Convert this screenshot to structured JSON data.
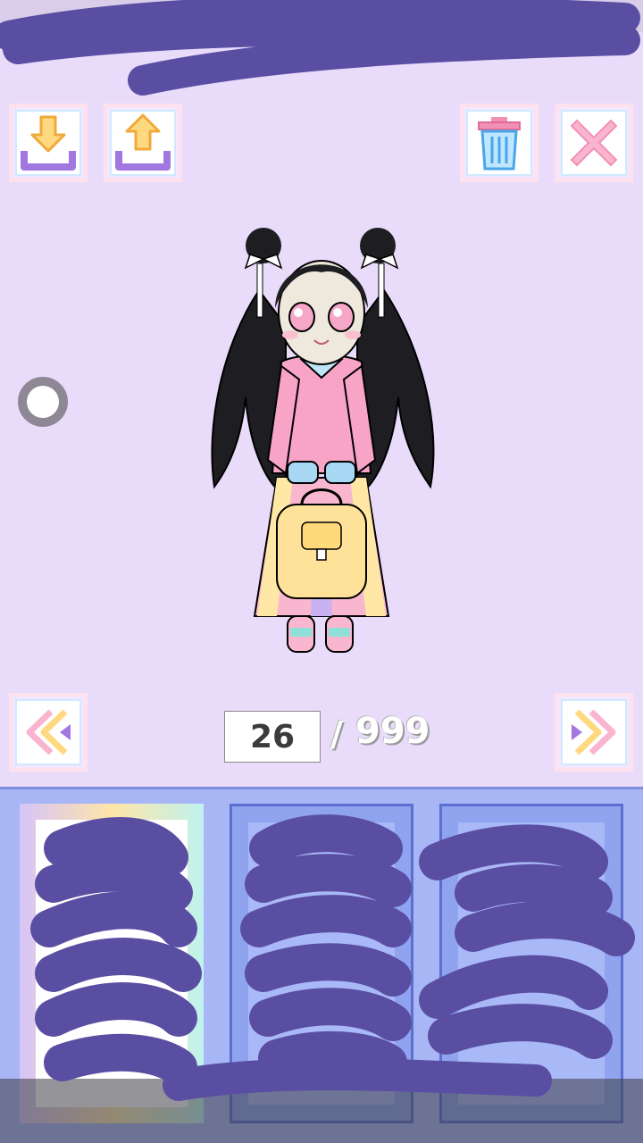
{
  "toolbar": {
    "download_icon": "download-tray-icon",
    "upload_icon": "upload-tray-icon",
    "trash_icon": "trash-icon",
    "close_icon": "close-x-icon"
  },
  "pager": {
    "current": "26",
    "separator": "/",
    "total": "999"
  },
  "colors": {
    "background": "#e9dcfb",
    "panel": "#a9b6f6",
    "scribble": "#5a4ea3"
  }
}
